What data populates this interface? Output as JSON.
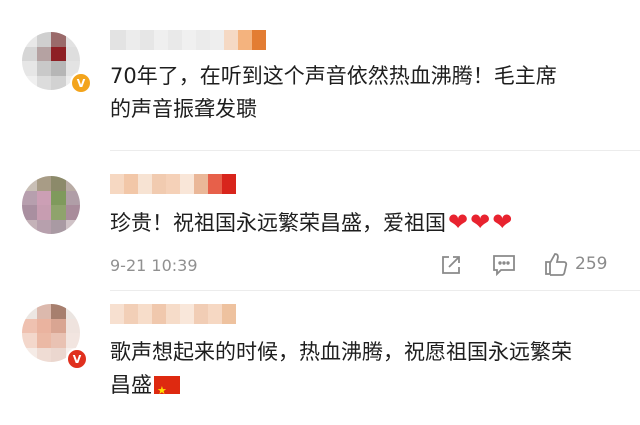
{
  "comments": [
    {
      "text_line1": "70年了，在听到这个声音依然热血沸腾！毛主席",
      "text_line2": "的声音振聋发聩",
      "badge": "V"
    },
    {
      "text": "珍贵！祝祖国永远繁荣昌盛，爱祖国",
      "timestamp": "9-21 10:39",
      "like_count": "259",
      "reactions": [
        "heart",
        "heart",
        "heart"
      ]
    },
    {
      "text_line1": "歌声想起来的时候，热血沸腾，祝愿祖国永远繁荣",
      "text_line2": "昌盛",
      "badge": "V",
      "emoji": "china-flag"
    }
  ],
  "icons": {
    "share": "share-icon",
    "comment": "comment-icon",
    "like": "thumbs-up-icon"
  },
  "colors": {
    "heart": "#e8232f",
    "badge_gold": "#f3a41c",
    "badge_red": "#e0301e",
    "meta_gray": "#909090"
  }
}
